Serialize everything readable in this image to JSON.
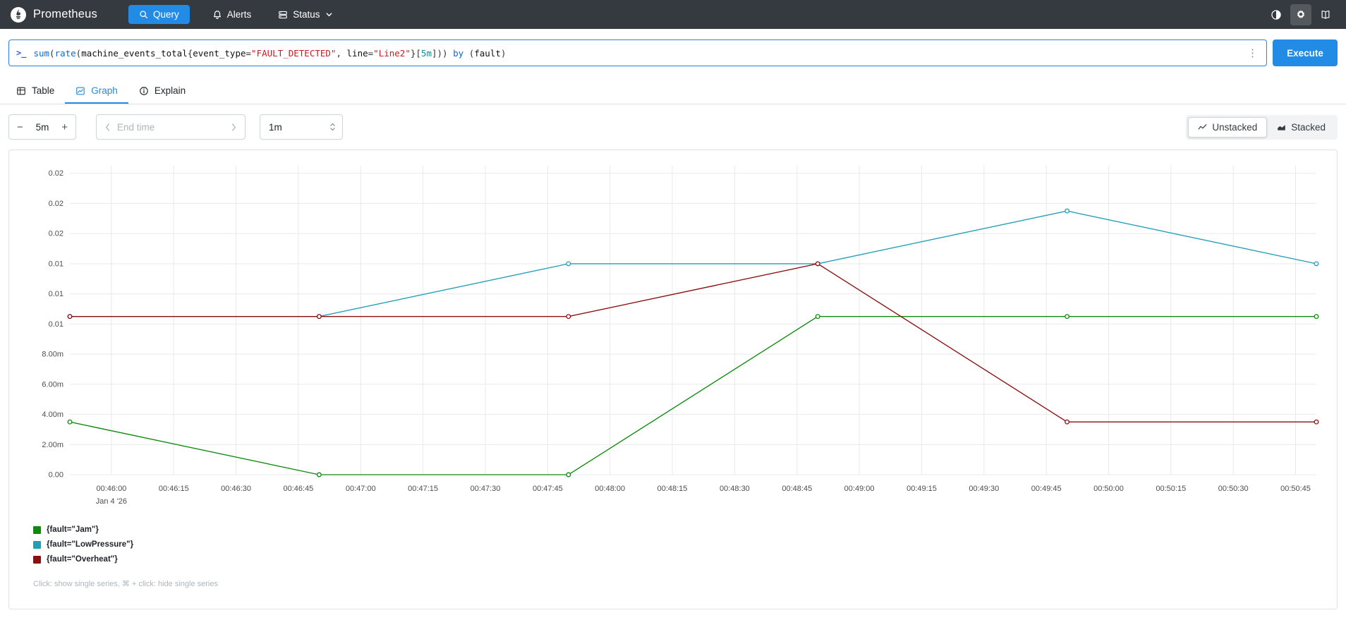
{
  "navbar": {
    "brand": "Prometheus",
    "query_label": "Query",
    "alerts_label": "Alerts",
    "status_label": "Status"
  },
  "query_bar": {
    "prompt": ">_",
    "kebab": "⋮",
    "execute_label": "Execute",
    "expression": "sum(rate(machine_events_total{event_type=\"FAULT_DETECTED\", line=\"Line2\"}[5m])) by (fault)",
    "tokens": [
      {
        "text": "sum",
        "type": "fn"
      },
      {
        "text": "(",
        "type": "paren"
      },
      {
        "text": "rate",
        "type": "fn"
      },
      {
        "text": "(",
        "type": "paren"
      },
      {
        "text": "machine_events_total",
        "type": "metric"
      },
      {
        "text": "{",
        "type": "paren"
      },
      {
        "text": "event_type",
        "type": "label"
      },
      {
        "text": "=",
        "type": "op"
      },
      {
        "text": "\"FAULT_DETECTED\"",
        "type": "string"
      },
      {
        "text": ", ",
        "type": "op"
      },
      {
        "text": "line",
        "type": "label"
      },
      {
        "text": "=",
        "type": "op"
      },
      {
        "text": "\"Line2\"",
        "type": "string"
      },
      {
        "text": "}",
        "type": "paren"
      },
      {
        "text": "[",
        "type": "paren"
      },
      {
        "text": "5m",
        "type": "duration"
      },
      {
        "text": "]",
        "type": "paren"
      },
      {
        "text": "))",
        "type": "paren"
      },
      {
        "text": " ",
        "type": "plain"
      },
      {
        "text": "by",
        "type": "keyword"
      },
      {
        "text": " ",
        "type": "plain"
      },
      {
        "text": "(",
        "type": "paren"
      },
      {
        "text": "fault",
        "type": "label"
      },
      {
        "text": ")",
        "type": "paren"
      }
    ]
  },
  "tabs": [
    {
      "label": "Table",
      "active": false
    },
    {
      "label": "Graph",
      "active": true
    },
    {
      "label": "Explain",
      "active": false
    }
  ],
  "controls": {
    "decrease_label": "−",
    "range_value": "5m",
    "increase_label": "+",
    "end_time_placeholder": "End time",
    "resolution_value": "1m",
    "unstacked_label": "Unstacked",
    "stacked_label": "Stacked"
  },
  "chart_data": {
    "type": "line",
    "title": "",
    "xlabel": "",
    "ylabel": "",
    "grid": true,
    "legend_position": "bottom-left",
    "x_min_seconds": 0,
    "x_max_seconds": 300,
    "y_min": 0,
    "y_max": 0.0205,
    "x_points_seconds": [
      0,
      60,
      120,
      180,
      240,
      300
    ],
    "x_points_times": [
      "00:45:50",
      "00:46:50",
      "00:47:50",
      "00:48:50",
      "00:49:50",
      "00:50:50"
    ],
    "series": [
      {
        "name": "{fault=\"Jam\"}",
        "color": "#0f8a0f",
        "values": [
          0.0035,
          0,
          0,
          0.0105,
          0.0105,
          0.0105
        ]
      },
      {
        "name": "{fault=\"LowPressure\"}",
        "color": "#209fb5",
        "values": [
          0.0105,
          0.0105,
          0.014,
          0.014,
          0.0175,
          0.014
        ]
      },
      {
        "name": "{fault=\"Overheat\"}",
        "color": "#8b1111",
        "values": [
          0.0105,
          0.0105,
          0.0105,
          0.014,
          0.0035,
          0.0035
        ]
      }
    ],
    "x_ticks": [
      {
        "t": 10,
        "label": "00:46:00",
        "sub_label": "Jan 4 '26"
      },
      {
        "t": 25,
        "label": "00:46:15"
      },
      {
        "t": 40,
        "label": "00:46:30"
      },
      {
        "t": 55,
        "label": "00:46:45"
      },
      {
        "t": 70,
        "label": "00:47:00"
      },
      {
        "t": 85,
        "label": "00:47:15"
      },
      {
        "t": 100,
        "label": "00:47:30"
      },
      {
        "t": 115,
        "label": "00:47:45"
      },
      {
        "t": 130,
        "label": "00:48:00"
      },
      {
        "t": 145,
        "label": "00:48:15"
      },
      {
        "t": 160,
        "label": "00:48:30"
      },
      {
        "t": 175,
        "label": "00:48:45"
      },
      {
        "t": 190,
        "label": "00:49:00"
      },
      {
        "t": 205,
        "label": "00:49:15"
      },
      {
        "t": 220,
        "label": "00:49:30"
      },
      {
        "t": 235,
        "label": "00:49:45"
      },
      {
        "t": 250,
        "label": "00:50:00"
      },
      {
        "t": 265,
        "label": "00:50:15"
      },
      {
        "t": 280,
        "label": "00:50:30"
      },
      {
        "t": 295,
        "label": "00:50:45"
      }
    ],
    "y_ticks": [
      {
        "v": 0,
        "label": "0.00"
      },
      {
        "v": 0.002,
        "label": "2.00m"
      },
      {
        "v": 0.004,
        "label": "4.00m"
      },
      {
        "v": 0.006,
        "label": "6.00m"
      },
      {
        "v": 0.008,
        "label": "8.00m"
      },
      {
        "v": 0.01,
        "label": "0.01"
      },
      {
        "v": 0.012,
        "label": "0.01"
      },
      {
        "v": 0.014,
        "label": "0.01"
      },
      {
        "v": 0.016,
        "label": "0.02"
      },
      {
        "v": 0.018,
        "label": "0.02"
      },
      {
        "v": 0.02,
        "label": "0.02"
      }
    ]
  },
  "legend_note": "Click: show single series, ⌘ + click: hide single series",
  "colors": {
    "accent_blue": "#228be6",
    "navbar_bg": "#343a40",
    "grid": "#e9e9e9"
  }
}
